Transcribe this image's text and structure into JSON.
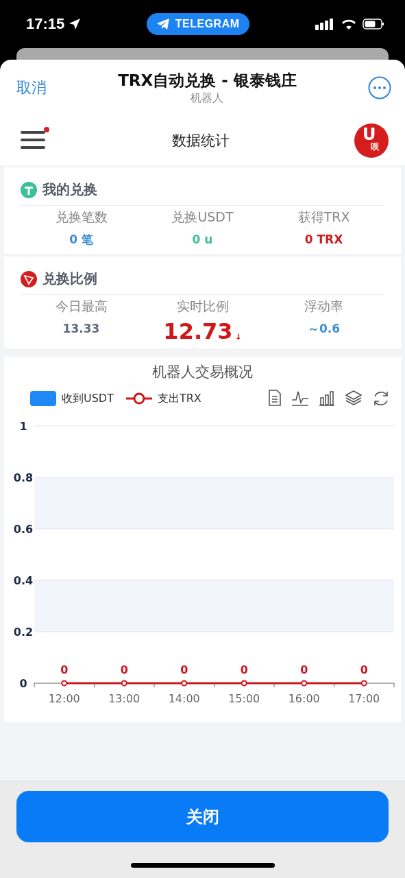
{
  "status_bar": {
    "time": "17:15",
    "pill": "TELEGRAM"
  },
  "header": {
    "cancel": "取消",
    "title": "TRX自动兑换 - 银泰钱庄",
    "subtitle": "机器人"
  },
  "nav": {
    "title": "数据统计",
    "menu_badge": true,
    "logo": {
      "mark": "U",
      "text": "呗"
    }
  },
  "cards": [
    {
      "title": "我的兑换",
      "kind": "tether",
      "stats": [
        {
          "label": "兑换笔数",
          "value": "0 笔",
          "color": "#3f8fd2"
        },
        {
          "label": "兑换USDT",
          "value": "0 u",
          "color": "#3dbf97"
        },
        {
          "label": "获得TRX",
          "value": "0 TRX",
          "color": "#cc1f1f"
        }
      ]
    },
    {
      "title": "兑换比例",
      "kind": "tron",
      "stats": [
        {
          "label": "今日最高",
          "value": "13.33",
          "color": "#5f6b7f"
        },
        {
          "label": "实时比例",
          "value": "12.73",
          "color": "#d0171b",
          "big": true,
          "trend": "↓"
        },
        {
          "label": "浮动率",
          "value": "～0.6",
          "color": "#3f8fd2"
        }
      ]
    }
  ],
  "chart": {
    "legend_swatches": [
      {
        "name": "收到USDT",
        "color": "#1e88f5"
      }
    ],
    "chart_data": {
      "type": "line",
      "title": "机器人交易概况",
      "categories": [
        "12:00",
        "13:00",
        "14:00",
        "15:00",
        "16:00",
        "17:00"
      ],
      "grid": true,
      "series": [
        {
          "name": "支出TRX",
          "color": "#d0171b",
          "marker": "circle",
          "values": [
            0,
            0,
            0,
            0,
            0,
            0
          ]
        }
      ],
      "ylim": [
        0,
        1
      ],
      "yticks": [
        {
          "value": 0,
          "label": "0"
        },
        {
          "value": 0.2,
          "label": "0.2"
        },
        {
          "value": 0.4,
          "label": "0.4"
        },
        {
          "value": 0.6,
          "label": "0.6"
        },
        {
          "value": 0.8,
          "label": "0.8"
        },
        {
          "value": 1,
          "label": "1"
        }
      ],
      "value_labels": [
        "0",
        "0",
        "0",
        "0",
        "0",
        "0"
      ]
    }
  },
  "footer": {
    "button": "关闭"
  }
}
